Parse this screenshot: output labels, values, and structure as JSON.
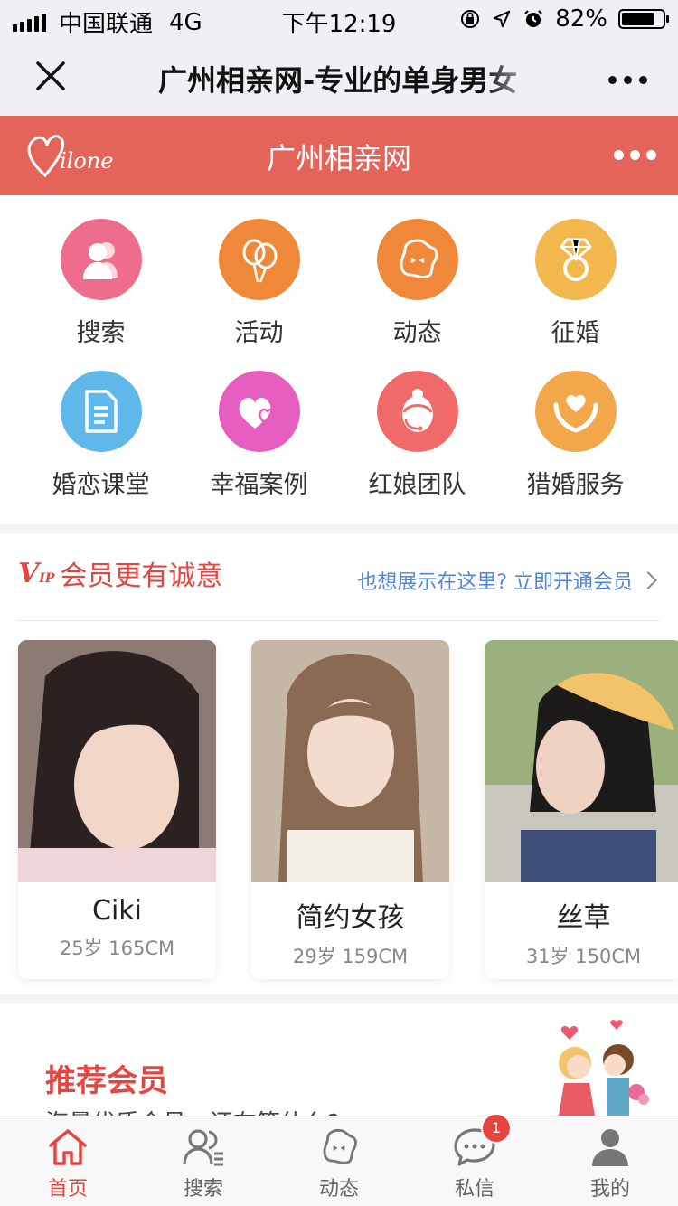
{
  "status_bar": {
    "carrier": "中国联通",
    "network": "4G",
    "time": "下午12:19",
    "battery_text": "82%",
    "battery_level": 0.82
  },
  "wechat_nav": {
    "title": "广州相亲网-专业的单身男女"
  },
  "site_header": {
    "logo_text": "Milone",
    "title": "广州相亲网",
    "brand_color": "#e5645a"
  },
  "menu_grid": [
    {
      "label": "搜索",
      "icon": "users-icon",
      "color": "#ee6c8c"
    },
    {
      "label": "活动",
      "icon": "balloons-icon",
      "color": "#f0883a"
    },
    {
      "label": "动态",
      "icon": "star-face-icon",
      "color": "#f0883a"
    },
    {
      "label": "征婚",
      "icon": "diamond-ring-icon",
      "color": "#f2b84e"
    },
    {
      "label": "婚恋课堂",
      "icon": "document-icon",
      "color": "#5fb7ea"
    },
    {
      "label": "幸福案例",
      "icon": "hearts-icon",
      "color": "#e55ec0"
    },
    {
      "label": "红娘团队",
      "icon": "matchmaker-icon",
      "color": "#f06a6a"
    },
    {
      "label": "猎婚服务",
      "icon": "heart-hands-icon",
      "color": "#f2a84a"
    }
  ],
  "vip_section": {
    "badge": "VIP",
    "title": "会员更有诚意",
    "link": "也想展示在这里? 立即开通会员",
    "members": [
      {
        "name": "Ciki",
        "info": "25岁 165CM"
      },
      {
        "name": "简约女孩",
        "info": "29岁 159CM"
      },
      {
        "name": "丝草",
        "info": "31岁 150CM"
      }
    ]
  },
  "recommended": {
    "title": "推荐会员",
    "subtitle": "海量优质会员，还在等什么?"
  },
  "tab_bar": {
    "tabs": [
      {
        "label": "首页",
        "icon": "home-icon"
      },
      {
        "label": "搜索",
        "icon": "search-users-icon"
      },
      {
        "label": "动态",
        "icon": "star-face-icon"
      },
      {
        "label": "私信",
        "icon": "chat-bubble-icon",
        "badge": "1"
      },
      {
        "label": "我的",
        "icon": "person-icon"
      }
    ],
    "active_color": "#e5453f"
  }
}
